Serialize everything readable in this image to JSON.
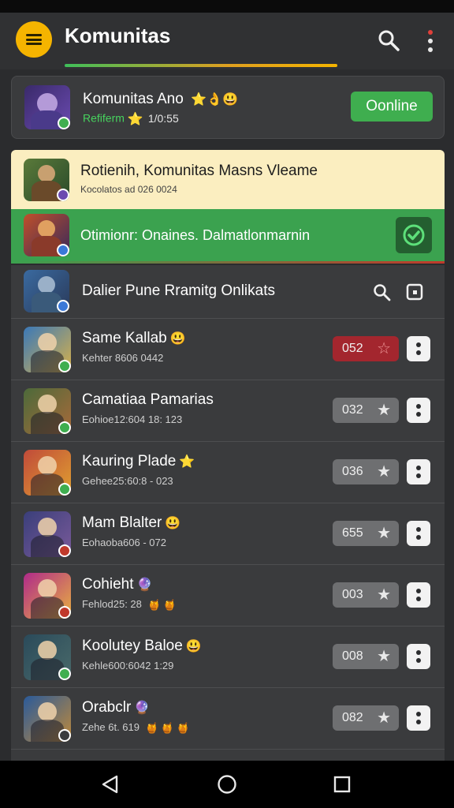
{
  "app": {
    "title": "Komunitas"
  },
  "profile": {
    "name": "Komunitas Ano",
    "name_emoji": "⭐👌😃",
    "status": "Refiferm",
    "status_emoji": "⭐",
    "date": "1/0:55",
    "online_label": "Oonline"
  },
  "featured": {
    "title": "Rotienih, Komunitas  Masns Vleame",
    "meta": "Kocolatos ad 026 0024"
  },
  "banner": {
    "text": "Otimionr: Onaines. Dalmatlonmarnin"
  },
  "list_header": {
    "title": "Dalier Pune Rramitg Onlikats"
  },
  "games": [
    {
      "name": "Same Kallab",
      "emoji": "😃",
      "meta": "Kehter 8606 0442",
      "meta_emoji": "",
      "score": "052",
      "highlight": true,
      "badge": "#3fae4f",
      "colors": [
        "#3a78b8",
        "#d9b24a"
      ]
    },
    {
      "name": "Camatiaa Pamarias",
      "emoji": "",
      "meta": "Eohioe12:604 18: 123",
      "meta_emoji": "",
      "score": "032",
      "highlight": false,
      "badge": "#3fae4f",
      "colors": [
        "#4c6a3a",
        "#a86a3a"
      ]
    },
    {
      "name": "Kauring Plade",
      "emoji": "⭐",
      "meta": "Gehee25:60:8 - 023",
      "meta_emoji": "",
      "score": "036",
      "highlight": false,
      "badge": "#3fae4f",
      "colors": [
        "#c04a3a",
        "#e0a030"
      ]
    },
    {
      "name": "Mam Blalter",
      "emoji": "😃",
      "meta": "Eohaoba606 - 072",
      "meta_emoji": "",
      "score": "655",
      "highlight": false,
      "badge": "#c0392b",
      "colors": [
        "#3a3f7a",
        "#7a5a9a"
      ]
    },
    {
      "name": "Cohieht",
      "emoji": "🔮",
      "meta": "Fehlod25: 28",
      "meta_emoji": "🍯 🍯",
      "score": "003",
      "highlight": false,
      "badge": "#c0392b",
      "colors": [
        "#b02a8a",
        "#e8b040"
      ]
    },
    {
      "name": "Koolutey Baloe",
      "emoji": "😃",
      "meta": "Kehle600:6042 1:29",
      "meta_emoji": "",
      "score": "008",
      "highlight": false,
      "badge": "#3fae4f",
      "colors": [
        "#2a4a5a",
        "#4a6a6a"
      ]
    },
    {
      "name": "Orabclr",
      "emoji": "🔮",
      "meta": "Zehe 6t. 619",
      "meta_emoji": "🍯 🍯 🍯",
      "score": "082",
      "highlight": false,
      "badge": "#3a3b3d",
      "colors": [
        "#2a5a9a",
        "#c08a3a"
      ]
    }
  ],
  "colors": {
    "accent": "#f5b400",
    "online": "#3fae4f",
    "banner": "#3ba24f",
    "featured_bg": "#fbeec0"
  }
}
